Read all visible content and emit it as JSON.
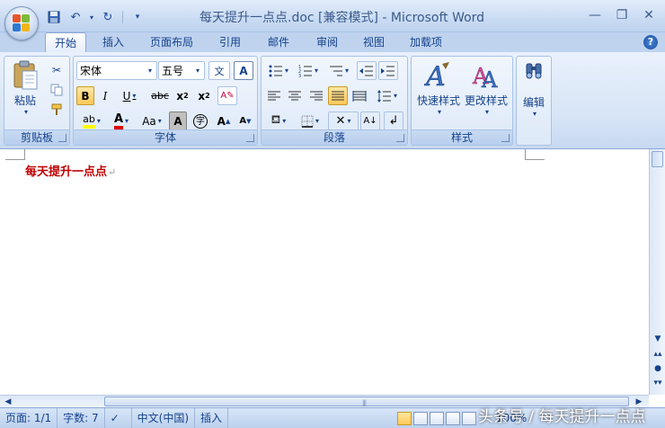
{
  "title": "每天提升一点点.doc [兼容模式] - Microsoft Word",
  "tabs": [
    "开始",
    "插入",
    "页面布局",
    "引用",
    "邮件",
    "审阅",
    "视图",
    "加载项"
  ],
  "ribbon": {
    "clipboard": {
      "label": "剪贴板",
      "paste": "粘贴"
    },
    "font": {
      "label": "字体",
      "font_name": "宋体",
      "font_size": "五号"
    },
    "paragraph": {
      "label": "段落"
    },
    "styles": {
      "label": "样式",
      "quick_styles": "快速样式",
      "change_styles": "更改样式"
    },
    "editing": {
      "label": "编辑"
    }
  },
  "document": {
    "text": "每天提升一点点",
    "para_mark": "↵"
  },
  "status": {
    "page": "页面: 1/1",
    "words": "字数: 7",
    "language": "中文(中国)",
    "mode": "插入",
    "zoom": "100%"
  },
  "watermark": "头条号 / 每天提升一点点"
}
